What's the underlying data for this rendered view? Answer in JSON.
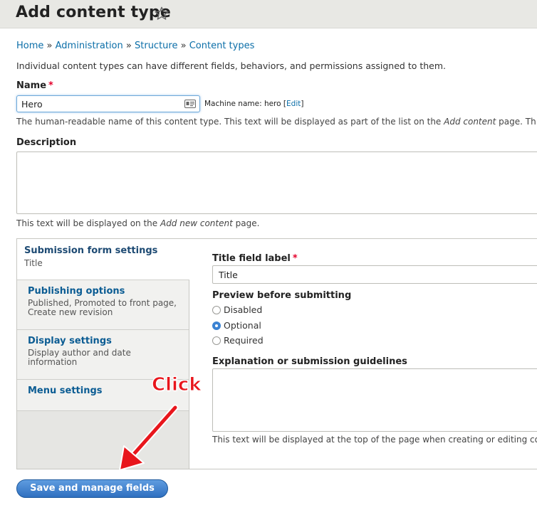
{
  "header": {
    "title": "Add content type",
    "icon": "star-outline-icon"
  },
  "breadcrumb": {
    "items": [
      "Home",
      "Administration",
      "Structure",
      "Content types"
    ],
    "separator": "»"
  },
  "intro": "Individual content types can have different fields, behaviors, and permissions assigned to them.",
  "name_field": {
    "label": "Name",
    "required_mark": "*",
    "value": "Hero",
    "machine_name_prefix": "Machine name: hero [",
    "machine_name_edit": "Edit",
    "machine_name_suffix": "]",
    "help_prefix": "The human-readable name of this content type. This text will be displayed as part of the list on the ",
    "help_emphasis": "Add content",
    "help_suffix": " page. Th"
  },
  "description_field": {
    "label": "Description",
    "value": "",
    "help_prefix": "This text will be displayed on the ",
    "help_emphasis": "Add new content",
    "help_suffix": " page."
  },
  "vertical_tabs": {
    "tabs": [
      {
        "title": "Submission form settings",
        "summary": "Title",
        "active": true
      },
      {
        "title": "Publishing options",
        "summary": "Published, Promoted to front page, Create new revision"
      },
      {
        "title": "Display settings",
        "summary": "Display author and date information"
      },
      {
        "title": "Menu settings",
        "summary": ""
      }
    ],
    "pane": {
      "title_label": "Title field label",
      "title_required_mark": "*",
      "title_value": "Title",
      "preview_label": "Preview before submitting",
      "preview_options": [
        "Disabled",
        "Optional",
        "Required"
      ],
      "preview_selected": "Optional",
      "explanation_label": "Explanation or submission guidelines",
      "explanation_value": "",
      "explanation_help": "This text will be displayed at the top of the page when creating or editing co"
    }
  },
  "actions": {
    "save_label": "Save and manage fields"
  },
  "annotation": {
    "text": "Click",
    "color": "#e8161c"
  },
  "colors": {
    "link": "#0b6ea8",
    "required": "#e4002b",
    "button": "#2f6fc0"
  }
}
